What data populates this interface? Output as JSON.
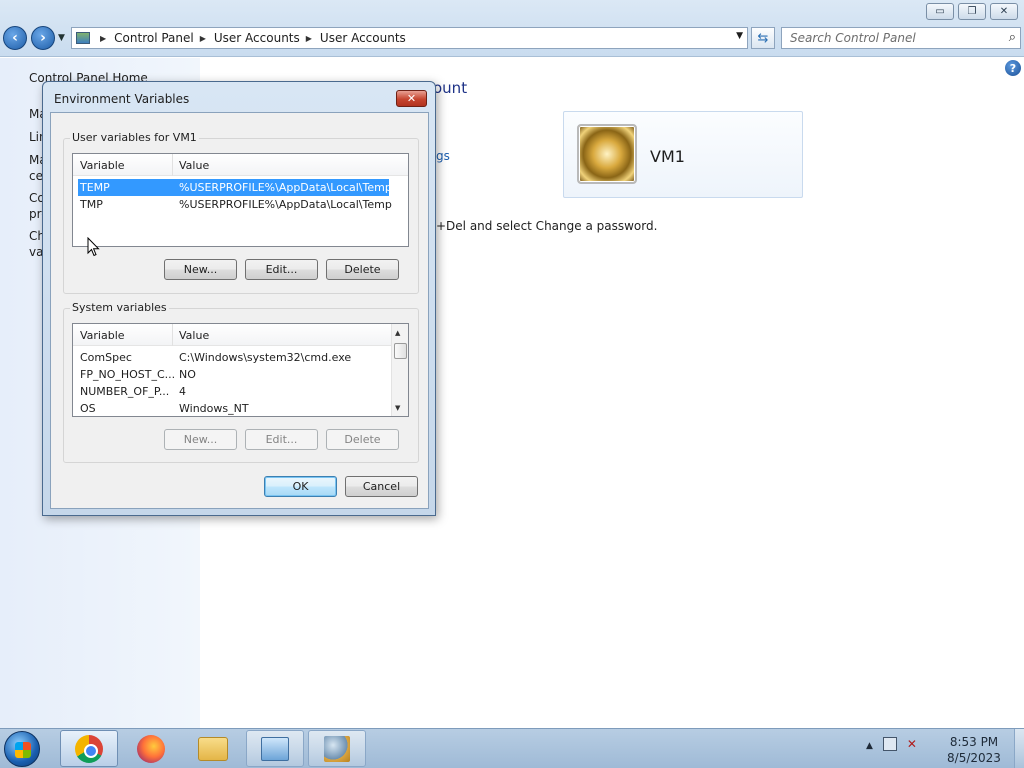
{
  "explorer": {
    "address": [
      "Control Panel",
      "User Accounts",
      "User Accounts"
    ],
    "search_placeholder": "Search Control Panel",
    "caption_buttons": {
      "minimize": "▭",
      "maximize": "❐",
      "close": "✕"
    }
  },
  "leftpane": {
    "links": [
      "Control Panel Home",
      "Ma",
      "Lin",
      "Ma",
      "ce",
      "Co",
      "pro",
      "Ch",
      "va"
    ]
  },
  "main": {
    "title_fragment": "ount",
    "link_fragment": "gs",
    "info_fragment": "+Del and select Change a password.",
    "user_name": "VM1"
  },
  "dialog": {
    "title": "Environment Variables",
    "user_group_label": "User variables for VM1",
    "system_group_label": "System variables",
    "columns": {
      "variable": "Variable",
      "value": "Value"
    },
    "user_vars": [
      {
        "name": "TEMP",
        "value": "%USERPROFILE%\\AppData\\Local\\Temp",
        "selected": true
      },
      {
        "name": "TMP",
        "value": "%USERPROFILE%\\AppData\\Local\\Temp",
        "selected": false
      }
    ],
    "system_vars": [
      {
        "name": "ComSpec",
        "value": "C:\\Windows\\system32\\cmd.exe"
      },
      {
        "name": "FP_NO_HOST_C...",
        "value": "NO"
      },
      {
        "name": "NUMBER_OF_P...",
        "value": "4"
      },
      {
        "name": "OS",
        "value": "Windows_NT"
      }
    ],
    "user_buttons": {
      "new": "New...",
      "edit": "Edit...",
      "delete": "Delete"
    },
    "system_buttons": {
      "new": "New...",
      "edit": "Edit...",
      "delete": "Delete"
    },
    "ok": "OK",
    "cancel": "Cancel",
    "close_glyph": "✕"
  },
  "taskbar": {
    "clock_time": "8:53 PM",
    "clock_date": "8/5/2023",
    "tray_arrow": "▲",
    "items": [
      "chrome",
      "firefox",
      "windows-explorer",
      "control-panel",
      "user-accounts"
    ]
  },
  "colors": {
    "selection": "#3399ff",
    "link": "#1c5fb0",
    "title_blue": "#1e3287"
  }
}
